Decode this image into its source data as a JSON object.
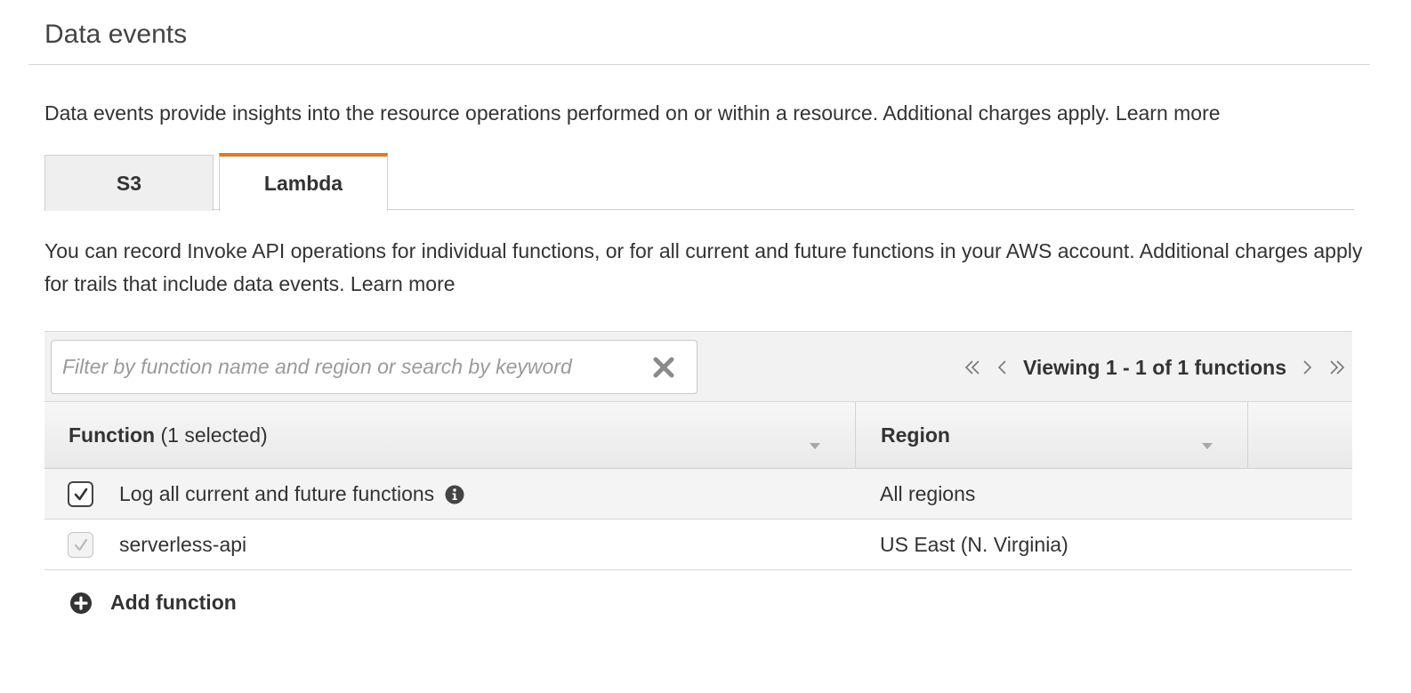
{
  "section": {
    "title": "Data events",
    "intro": "Data events provide insights into the resource operations performed on or within a resource. Additional charges apply.",
    "learn_more": "Learn more"
  },
  "tabs": [
    {
      "label": "S3",
      "active": false
    },
    {
      "label": "Lambda",
      "active": true
    }
  ],
  "lambda": {
    "description": "You can record Invoke API operations for individual functions, or for all current and future functions in your AWS account. Additional charges apply for trails that include data events.",
    "learn_more": "Learn more",
    "filter_placeholder": "Filter by function name and region or search by keyword",
    "pager_text": "Viewing 1 - 1 of 1 functions",
    "columns": {
      "function_bold": "Function",
      "function_suffix": "(1 selected)",
      "region": "Region"
    },
    "rows": [
      {
        "function": "Log all current and future functions",
        "region": "All regions",
        "checked": true,
        "disabled": false
      },
      {
        "function": "serverless-api",
        "region": "US East (N. Virginia)",
        "checked": true,
        "disabled": true
      }
    ],
    "add_function": "Add function"
  },
  "colors": {
    "active_tab_accent": "#e07b24",
    "toolbar_bg": "#f2f2f2",
    "text": "#333333"
  },
  "icons": [
    "clear-filter-icon",
    "first-page-icon",
    "previous-page-icon",
    "next-page-icon",
    "last-page-icon",
    "sort-icon",
    "checkmark-icon",
    "info-icon",
    "add-circle-icon"
  ]
}
